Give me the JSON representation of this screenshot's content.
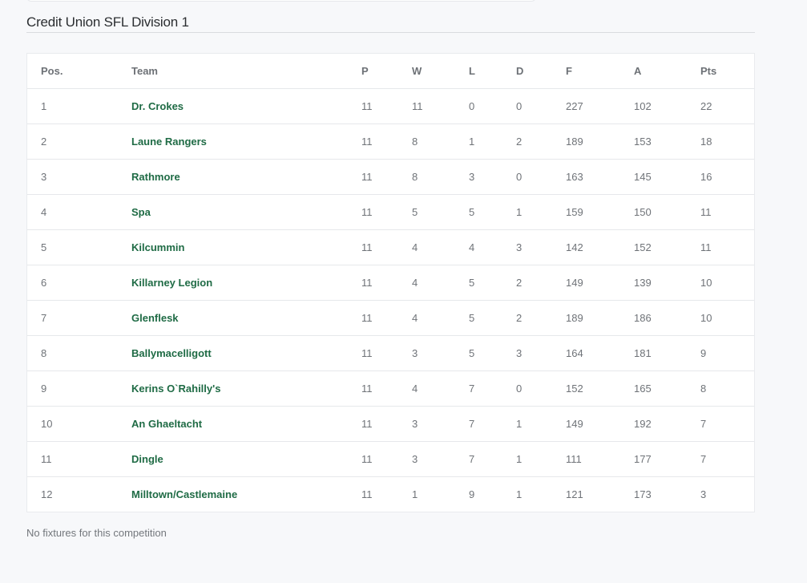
{
  "competition": {
    "title": "Credit Union SFL Division 1"
  },
  "table": {
    "headers": {
      "pos": "Pos.",
      "team": "Team",
      "p": "P",
      "w": "W",
      "l": "L",
      "d": "D",
      "f": "F",
      "a": "A",
      "pts": "Pts"
    },
    "rows": [
      {
        "pos": "1",
        "team": "Dr. Crokes",
        "p": "11",
        "w": "11",
        "l": "0",
        "d": "0",
        "f": "227",
        "a": "102",
        "pts": "22"
      },
      {
        "pos": "2",
        "team": "Laune Rangers",
        "p": "11",
        "w": "8",
        "l": "1",
        "d": "2",
        "f": "189",
        "a": "153",
        "pts": "18"
      },
      {
        "pos": "3",
        "team": "Rathmore",
        "p": "11",
        "w": "8",
        "l": "3",
        "d": "0",
        "f": "163",
        "a": "145",
        "pts": "16"
      },
      {
        "pos": "4",
        "team": "Spa",
        "p": "11",
        "w": "5",
        "l": "5",
        "d": "1",
        "f": "159",
        "a": "150",
        "pts": "11"
      },
      {
        "pos": "5",
        "team": "Kilcummin",
        "p": "11",
        "w": "4",
        "l": "4",
        "d": "3",
        "f": "142",
        "a": "152",
        "pts": "11"
      },
      {
        "pos": "6",
        "team": "Killarney Legion",
        "p": "11",
        "w": "4",
        "l": "5",
        "d": "2",
        "f": "149",
        "a": "139",
        "pts": "10"
      },
      {
        "pos": "7",
        "team": "Glenflesk",
        "p": "11",
        "w": "4",
        "l": "5",
        "d": "2",
        "f": "189",
        "a": "186",
        "pts": "10"
      },
      {
        "pos": "8",
        "team": "Ballymacelligott",
        "p": "11",
        "w": "3",
        "l": "5",
        "d": "3",
        "f": "164",
        "a": "181",
        "pts": "9"
      },
      {
        "pos": "9",
        "team": "Kerins O`Rahilly's",
        "p": "11",
        "w": "4",
        "l": "7",
        "d": "0",
        "f": "152",
        "a": "165",
        "pts": "8"
      },
      {
        "pos": "10",
        "team": "An Ghaeltacht",
        "p": "11",
        "w": "3",
        "l": "7",
        "d": "1",
        "f": "149",
        "a": "192",
        "pts": "7"
      },
      {
        "pos": "11",
        "team": "Dingle",
        "p": "11",
        "w": "3",
        "l": "7",
        "d": "1",
        "f": "111",
        "a": "177",
        "pts": "7"
      },
      {
        "pos": "12",
        "team": "Milltown/Castlemaine",
        "p": "11",
        "w": "1",
        "l": "9",
        "d": "1",
        "f": "121",
        "a": "173",
        "pts": "3"
      }
    ]
  },
  "fixtures": {
    "empty_message": "No fixtures for this competition"
  },
  "colors": {
    "team_link": "#1f6b45",
    "page_background": "#f7f8fa",
    "title_text": "#2b2e31"
  }
}
